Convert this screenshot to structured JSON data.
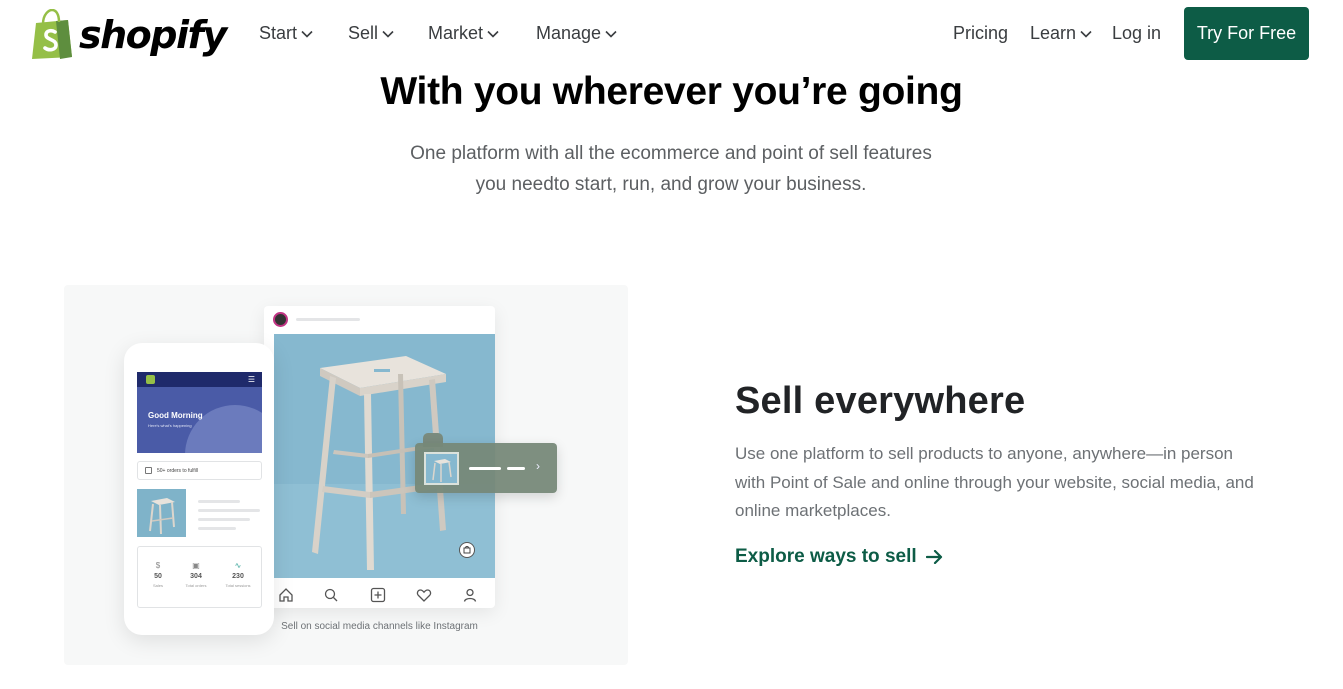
{
  "brand": {
    "name": "shopify",
    "logo_color": "#95bf47"
  },
  "nav": {
    "left_items": [
      {
        "label": "Start",
        "has_dropdown": true
      },
      {
        "label": "Sell",
        "has_dropdown": true
      },
      {
        "label": "Market",
        "has_dropdown": true
      },
      {
        "label": "Manage",
        "has_dropdown": true
      }
    ],
    "right_items": [
      {
        "label": "Pricing",
        "has_dropdown": false
      },
      {
        "label": "Learn",
        "has_dropdown": true
      },
      {
        "label": "Log in",
        "has_dropdown": false
      }
    ],
    "cta_label": "Try For Free",
    "cta_color": "#0d5c46"
  },
  "hero": {
    "title": "With you wherever you’re going",
    "subtitle_line1": "One platform with all the ecommerce and point of sell features",
    "subtitle_line2": "you needto start, run, and grow your business."
  },
  "illustration": {
    "phone": {
      "greeting": "Good Morning",
      "greeting_sub": "Here's what's happening",
      "orders_text": "50+ orders to fulfill",
      "stats": [
        {
          "value": "50",
          "label": "Sales",
          "icon": "dollar-icon"
        },
        {
          "value": "304",
          "label": "Total orders",
          "icon": "orders-icon"
        },
        {
          "value": "230",
          "label": "Total sessions",
          "icon": "sessions-icon"
        }
      ]
    },
    "caption": "Sell on social media channels like Instagram"
  },
  "feature": {
    "title": "Sell everywhere",
    "body": "Use one platform to sell products to anyone, anywhere—in person with Point of Sale and online through your website, social media, and online marketplaces.",
    "link_label": "Explore ways to sell",
    "link_color": "#0d5c46"
  }
}
